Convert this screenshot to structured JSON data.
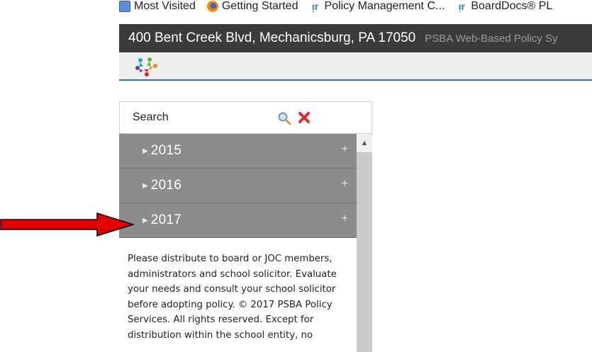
{
  "bookmarks": [
    {
      "label": "Most Visited",
      "icon": "most-visited-icon"
    },
    {
      "label": "Getting Started",
      "icon": "firefox-icon"
    },
    {
      "label": "Policy Management C...",
      "icon": "boarddocs-icon"
    },
    {
      "label": "BoardDocs® PL",
      "icon": "boarddocs-icon"
    }
  ],
  "header": {
    "address": "400 Bent Creek Blvd, Mechanicsburg, PA 17050",
    "system_name": "PSBA Web-Based Policy Sy"
  },
  "sidebar": {
    "search_label": "Search",
    "years": [
      {
        "label": "2015",
        "expand": "+"
      },
      {
        "label": "2016",
        "expand": "+"
      },
      {
        "label": "2017",
        "expand": "+"
      }
    ],
    "disclaimer": "Please distribute to board or JOC members, administrators and school solicitor. Evaluate your needs and consult your school solicitor before adopting policy. © 2017 PSBA Policy Services. All rights reserved. Except for distribution within the school entity, no"
  },
  "colors": {
    "titlebar": "#3b3b3b",
    "year_row": "#8c8c8c",
    "arrow": "#e30000",
    "accent_line": "#3a6ea8"
  }
}
